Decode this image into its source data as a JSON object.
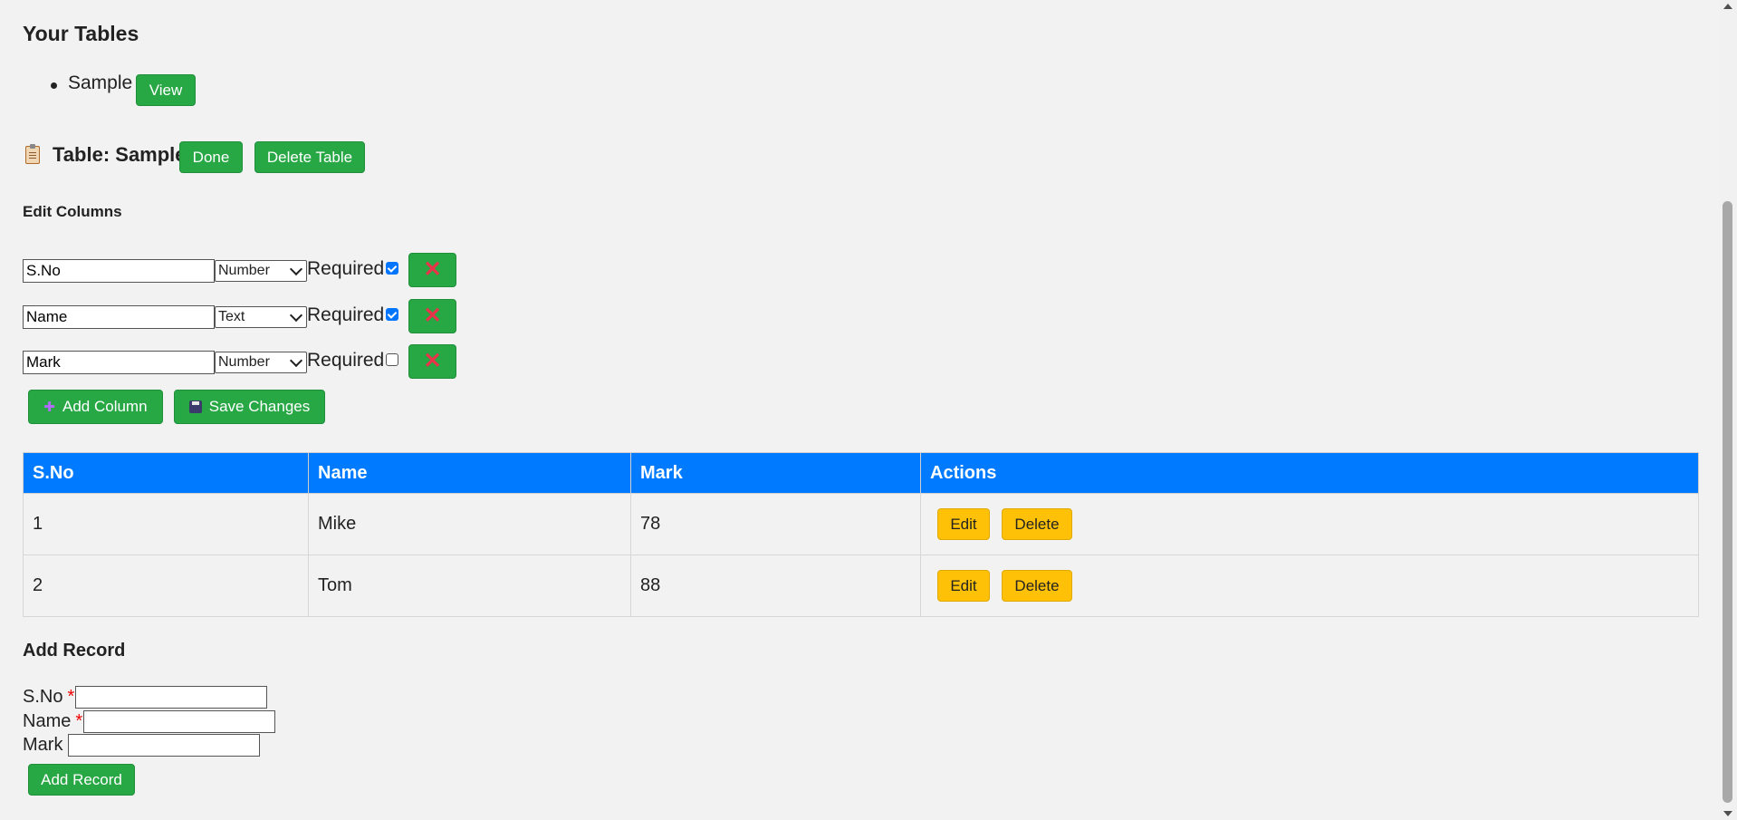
{
  "tables_section": {
    "heading": "Your Tables",
    "items": [
      {
        "name": "Sample",
        "view_label": "View"
      }
    ]
  },
  "table_header": {
    "icon": "clipboard-icon",
    "title": "Table: Sample",
    "done_label": "Done",
    "delete_label": "Delete Table"
  },
  "edit_columns": {
    "heading": "Edit Columns",
    "required_label": "Required",
    "remove_icon": "close-x-icon",
    "columns": [
      {
        "name": "S.No",
        "type": "Number",
        "required": true
      },
      {
        "name": "Name",
        "type": "Text",
        "required": true
      },
      {
        "name": "Mark",
        "type": "Number",
        "required": false
      }
    ],
    "add_column_label": "Add Column",
    "add_column_icon": "plus-icon",
    "save_changes_label": "Save Changes",
    "save_changes_icon": "floppy-disk-icon"
  },
  "records_table": {
    "headers": [
      "S.No",
      "Name",
      "Mark",
      "Actions"
    ],
    "rows": [
      {
        "sno": "1",
        "name": "Mike",
        "mark": "78"
      },
      {
        "sno": "2",
        "name": "Tom",
        "mark": "88"
      }
    ],
    "edit_label": "Edit",
    "delete_label": "Delete"
  },
  "add_record": {
    "heading": "Add Record",
    "fields": [
      {
        "label": "S.No",
        "required": true,
        "star": "*"
      },
      {
        "label": "Name",
        "required": true,
        "star": "*"
      },
      {
        "label": "Mark",
        "required": false,
        "star": ""
      }
    ],
    "submit_label": "Add Record"
  },
  "colors": {
    "green": "#28a745",
    "blue_header": "#007bff",
    "yellow": "#ffc107",
    "remove_x": "#e8334a",
    "page_bg": "#f2f2f2"
  }
}
